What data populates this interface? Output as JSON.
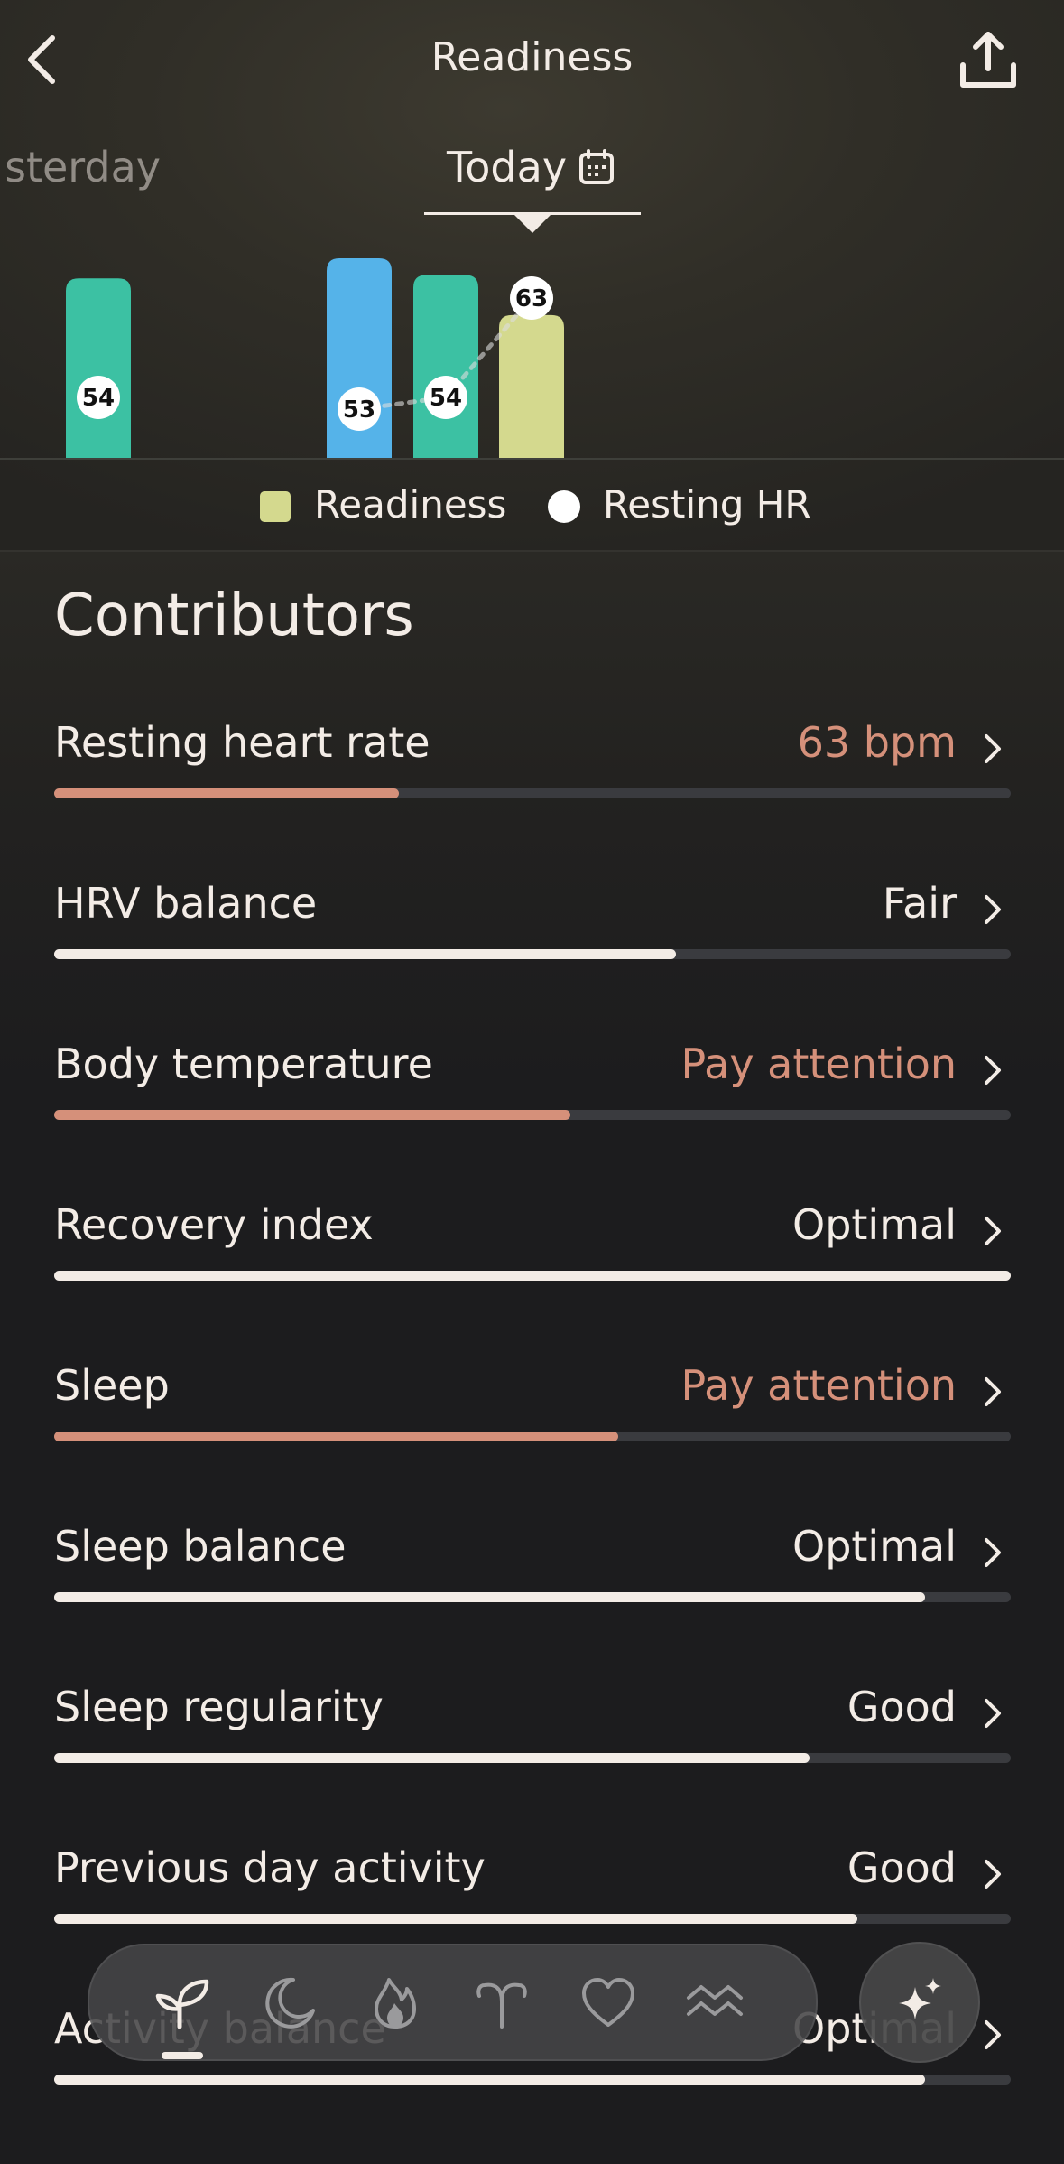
{
  "header": {
    "title": "Readiness",
    "back_icon": "chevron-left-icon",
    "share_icon": "share-icon"
  },
  "days": {
    "previous": "Yesterday",
    "current": "Today",
    "calendar_icon": "calendar-icon"
  },
  "chart_data": {
    "type": "bar",
    "visible_labels": [
      "54",
      "53",
      "54",
      "63"
    ],
    "bars": [
      {
        "series": "Readiness",
        "value": 54,
        "color": "#3cc1a3",
        "label": "54"
      },
      {
        "series": "Readiness",
        "value": 60,
        "color": "#55b3e9",
        "label": "53"
      },
      {
        "series": "Readiness",
        "value": 55,
        "color": "#3cc1a3",
        "label": "54"
      },
      {
        "series": "Readiness",
        "value": 43,
        "color": "#d4d98e",
        "label": "63"
      }
    ],
    "resting_hr_line": [
      53,
      54,
      63
    ],
    "legend": [
      "Readiness",
      "Resting HR"
    ]
  },
  "legend": {
    "readiness_label": "Readiness",
    "readiness_color": "#d4d98e",
    "hr_label": "Resting HR",
    "hr_color": "#ffffff"
  },
  "contributors": {
    "title": "Contributors",
    "items": [
      {
        "label": "Resting heart rate",
        "status": "63 bpm",
        "level": 0.36,
        "color": "#d5907a"
      },
      {
        "label": "HRV balance",
        "status": "Fair",
        "level": 0.65,
        "color": "#f3ece6"
      },
      {
        "label": "Body temperature",
        "status": "Pay attention",
        "level": 0.54,
        "color": "#d5907a"
      },
      {
        "label": "Recovery index",
        "status": "Optimal",
        "level": 1.0,
        "color": "#f3ece6"
      },
      {
        "label": "Sleep",
        "status": "Pay attention",
        "level": 0.59,
        "color": "#d5907a"
      },
      {
        "label": "Sleep balance",
        "status": "Optimal",
        "level": 0.91,
        "color": "#f3ece6"
      },
      {
        "label": "Sleep regularity",
        "status": "Good",
        "level": 0.79,
        "color": "#f3ece6"
      },
      {
        "label": "Previous day activity",
        "status": "Good",
        "level": 0.84,
        "color": "#f3ece6"
      },
      {
        "label": "Activity balance",
        "status": "Optimal",
        "level": 0.91,
        "color": "#f3ece6"
      }
    ]
  },
  "tabbar": {
    "items": [
      "readiness-sprout-icon",
      "sleep-moon-icon",
      "activity-flame-icon",
      "cycle-icon",
      "heart-icon",
      "stress-waves-icon"
    ],
    "active": 0,
    "assistant_icon": "sparkle-icon"
  },
  "colors": {
    "accent_warning": "#d5907a",
    "text": "#f3ece6",
    "readiness": "#d4d98e",
    "teal": "#3cc1a3",
    "blue": "#55b3e9"
  }
}
